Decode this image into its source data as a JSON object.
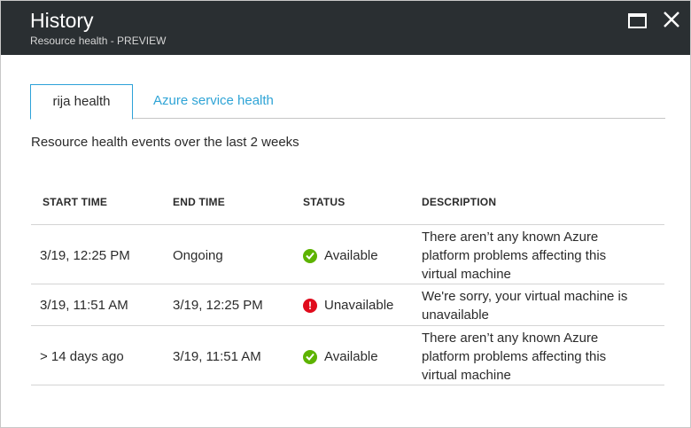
{
  "header": {
    "title": "History",
    "subtitle": "Resource health - PREVIEW"
  },
  "tabs": [
    {
      "label": "rija health",
      "active": true
    },
    {
      "label": "Azure service health",
      "active": false
    }
  ],
  "caption": "Resource health events over the last 2 weeks",
  "table": {
    "columns": [
      "START TIME",
      "END TIME",
      "STATUS",
      "DESCRIPTION"
    ],
    "rows": [
      {
        "start": "3/19, 12:25 PM",
        "end": "Ongoing",
        "status": "Available",
        "status_icon": "checkmark-icon",
        "description": [
          "There aren’t any known Azure",
          "platform problems affecting this",
          "virtual machine"
        ]
      },
      {
        "start": "3/19, 11:51 AM",
        "end": "3/19, 12:25 PM",
        "status": "Unavailable",
        "status_icon": "error-icon",
        "description": [
          "We're sorry, your virtual machine is",
          "unavailable"
        ]
      },
      {
        "start": "> 14 days ago",
        "end": "3/19, 11:51 AM",
        "status": "Available",
        "status_icon": "checkmark-icon",
        "description": [
          "There aren’t any known Azure",
          "platform problems affecting this",
          "virtual machine"
        ]
      }
    ]
  },
  "colors": {
    "header_bg": "#2a2f32",
    "accent": "#2fa4d6",
    "available": "#5db300",
    "unavailable": "#e00b1c"
  }
}
